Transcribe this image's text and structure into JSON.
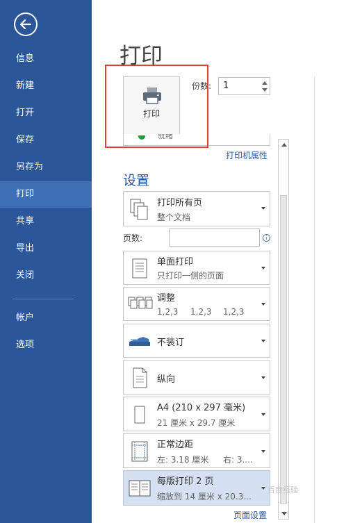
{
  "sidebar": {
    "items": [
      {
        "label": "信息"
      },
      {
        "label": "新建"
      },
      {
        "label": "打开"
      },
      {
        "label": "保存"
      },
      {
        "label": "另存为"
      },
      {
        "label": "打印"
      },
      {
        "label": "共享"
      },
      {
        "label": "导出"
      },
      {
        "label": "关闭"
      },
      {
        "label": "帐户"
      },
      {
        "label": "选项"
      }
    ],
    "active_item": "打印"
  },
  "main": {
    "title": "打印",
    "print_button_label": "打印",
    "copies_label": "份数:",
    "copies_value": "1",
    "printer_partial_text": "就绪",
    "printer_properties_link": "打印机属性",
    "settings_title": "设置",
    "pages_label": "页数:",
    "pages_value": "",
    "page_setup_link": "页面设置"
  },
  "settings": [
    {
      "title": "打印所有页",
      "subtitle": "整个文档",
      "icon": "pages-icon"
    },
    {
      "title": "单面打印",
      "subtitle": "只打印一侧的页面",
      "icon": "one-sided-icon"
    },
    {
      "title": "调整",
      "subtitle_parts": [
        "1,2,3",
        "1,2,3",
        "1,2,3"
      ],
      "icon": "collate-icon"
    },
    {
      "title": "不装订",
      "icon": "stapler-icon"
    },
    {
      "title": "纵向",
      "icon": "portrait-icon"
    },
    {
      "title": "A4 (210 x 297 毫米)",
      "subtitle": "21 厘米 x 29.7 厘米",
      "icon": "paper-size-icon"
    },
    {
      "title": "正常边距",
      "subtitle_left": "左: 3.18 厘米",
      "subtitle_right": "右: 3....",
      "icon": "margins-icon"
    },
    {
      "title": "每版打印 2 页",
      "subtitle": "缩放到 14 厘米 x 20.3...",
      "icon": "pages-per-sheet-icon",
      "selected": true
    }
  ],
  "watermark": "百度经验",
  "colors": {
    "sidebar_bg": "#2b579a",
    "sidebar_active": "#3f6fb4",
    "accent_text": "#2b579a",
    "highlight_border": "#e03b3b",
    "selected_option_bg": "#d5e1f2"
  }
}
